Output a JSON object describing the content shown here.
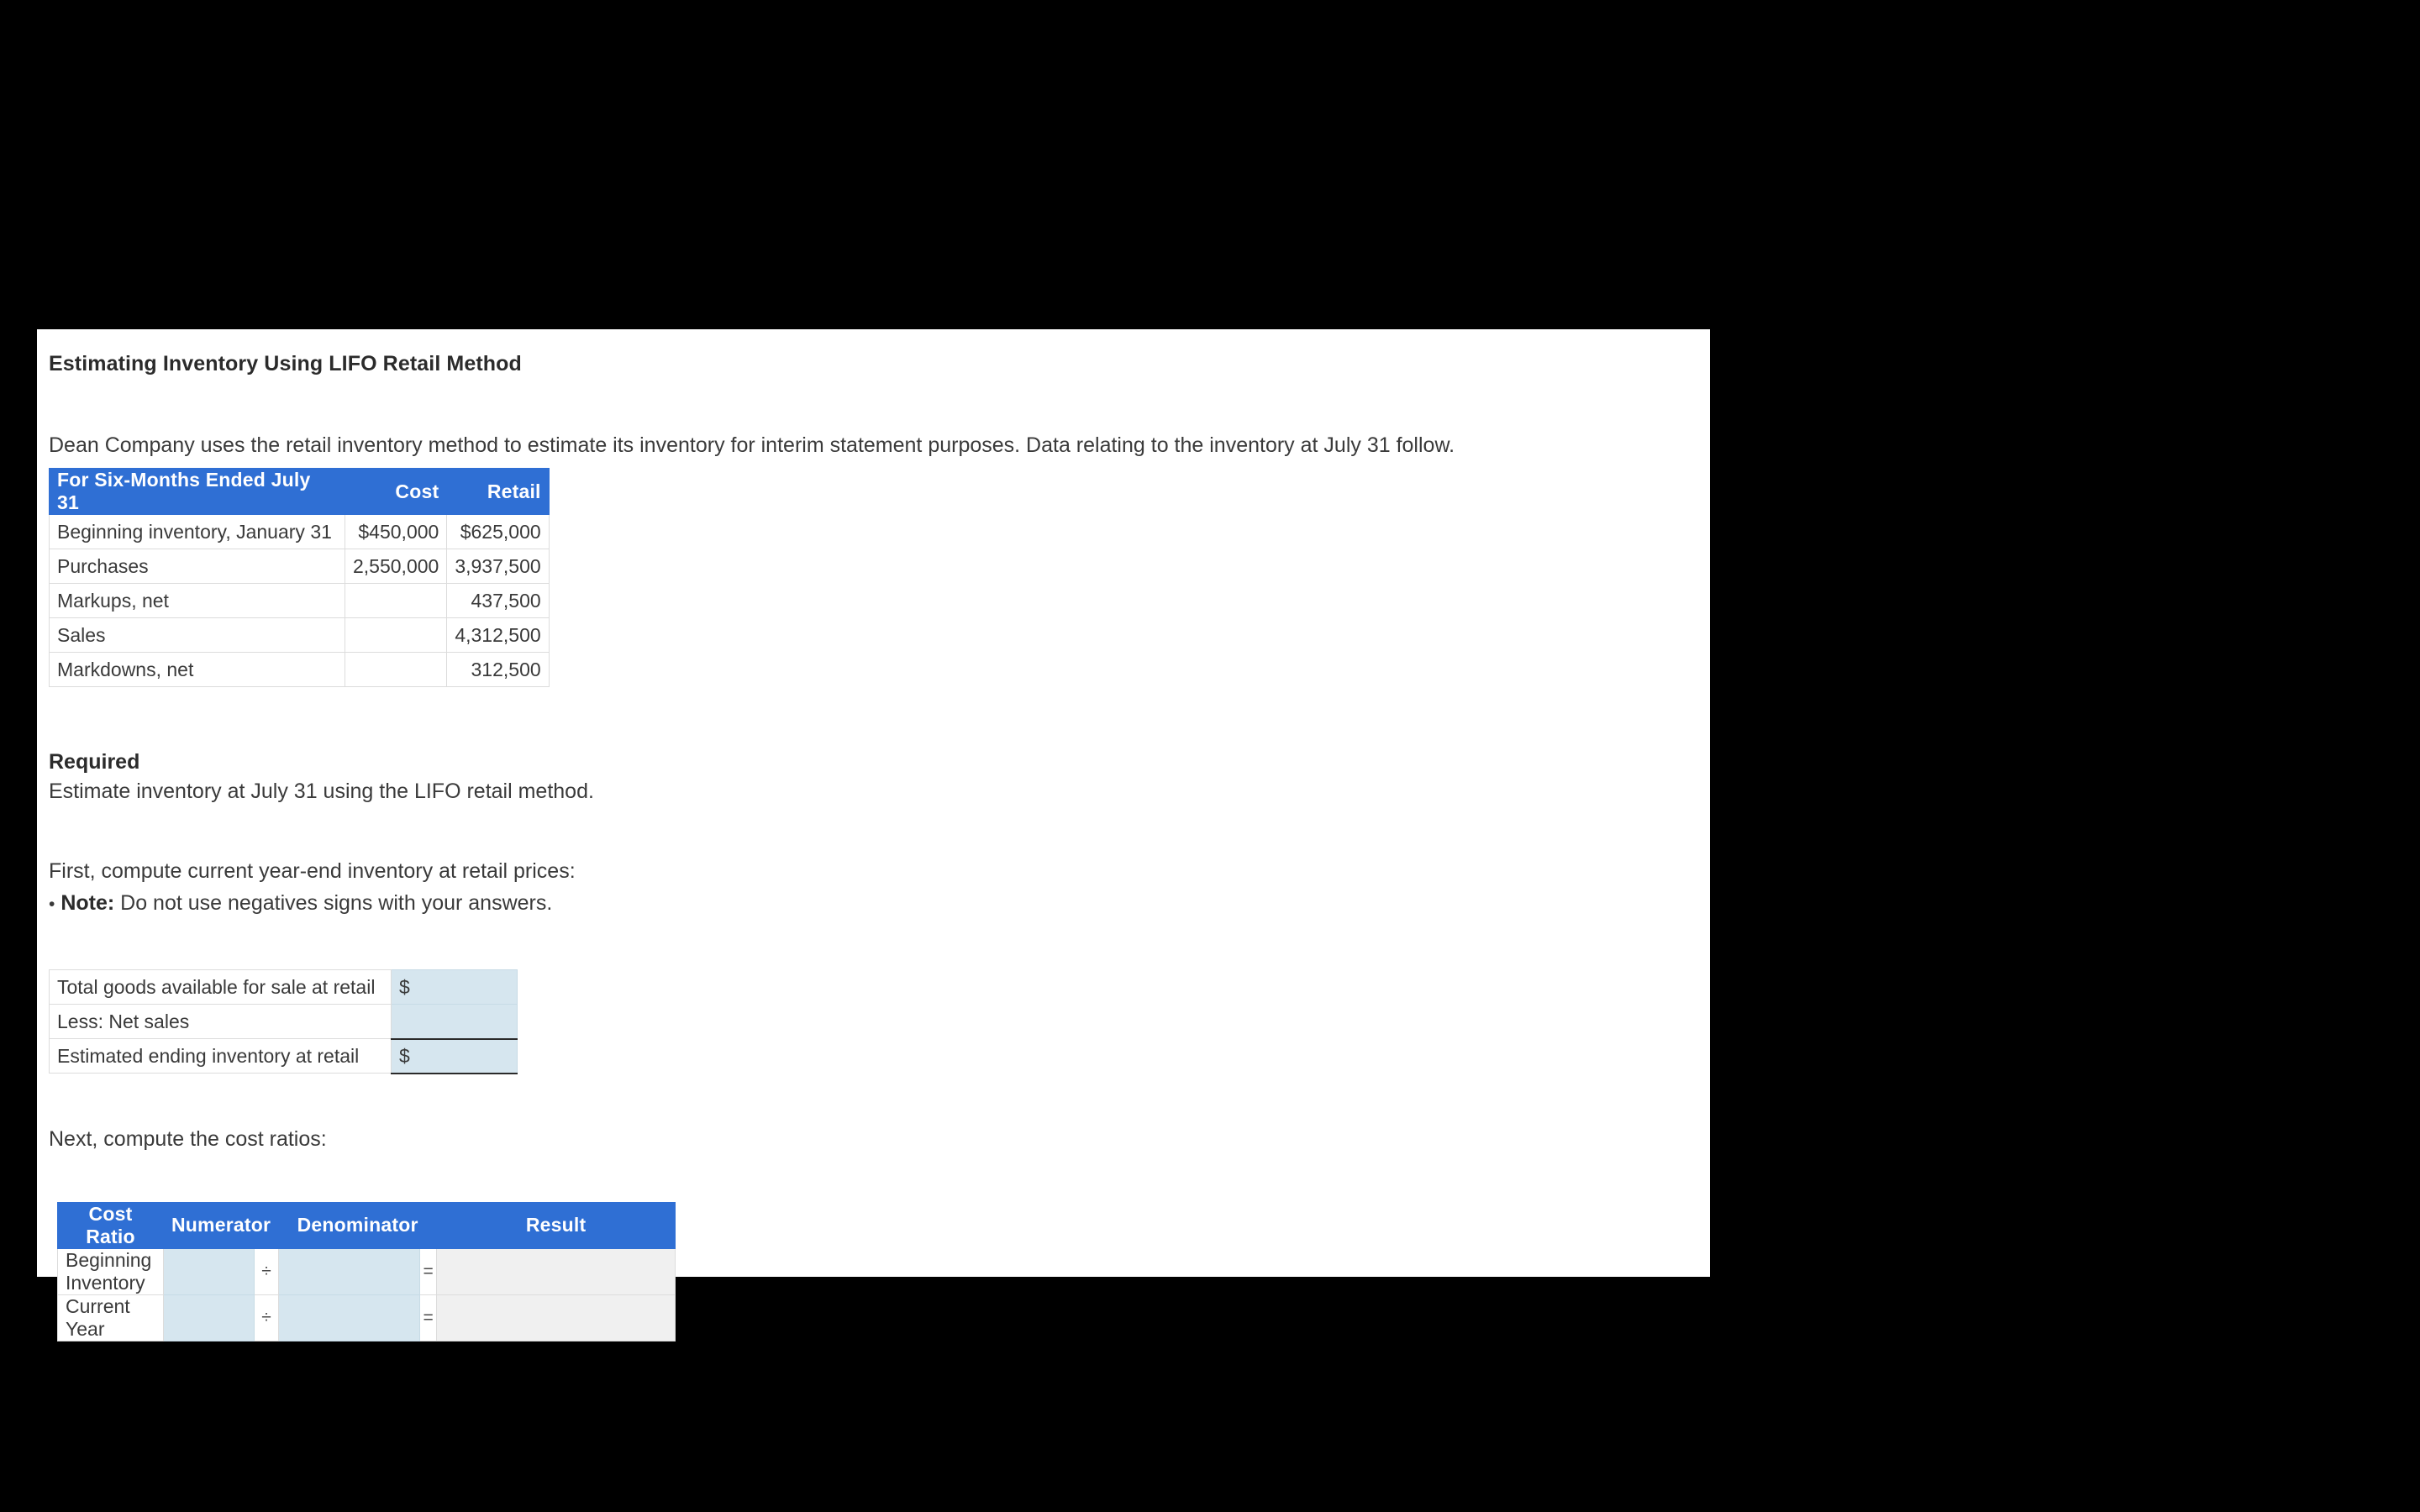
{
  "document": {
    "title": "Estimating Inventory Using LIFO Retail Method",
    "intro": "Dean Company uses the retail inventory method to estimate its inventory for interim statement purposes. Data relating to the inventory at July 31 follow.",
    "required_heading": "Required",
    "required_text": "Estimate inventory at July 31 using the LIFO retail method.",
    "first_instruction": "First, compute current year-end inventory at retail prices:",
    "note_bullet": "•",
    "note_label": "Note:",
    "note_text": "Do not use negatives signs with your answers.",
    "next_instruction": "Next, compute the cost ratios:"
  },
  "colors": {
    "header_blue": "#2f6fd4",
    "input_blue": "#d6e6ef",
    "result_gray": "#f0f0f0",
    "border_gray": "#dcdcdc",
    "text": "#3a3a3a",
    "page_background": "#000000",
    "content_background": "#ffffff"
  },
  "data_table": {
    "headers": [
      "For Six-Months Ended July 31",
      "Cost",
      "Retail"
    ],
    "rows": [
      {
        "label": "Beginning inventory, January 31",
        "cost": "$450,000",
        "retail": "$625,000"
      },
      {
        "label": "Purchases",
        "cost": "2,550,000",
        "retail": "3,937,500"
      },
      {
        "label": "Markups, net",
        "cost": "",
        "retail": "437,500"
      },
      {
        "label": "Sales",
        "cost": "",
        "retail": "4,312,500"
      },
      {
        "label": "Markdowns, net",
        "cost": "",
        "retail": "312,500"
      }
    ]
  },
  "retail_table": {
    "rows": [
      {
        "label": "Total goods available for sale at retail",
        "prefix": "$",
        "value": ""
      },
      {
        "label": "Less: Net sales",
        "prefix": "",
        "value": ""
      },
      {
        "label": "Estimated ending inventory at retail",
        "prefix": "$",
        "value": ""
      }
    ]
  },
  "ratio_table": {
    "headers": [
      "Cost Ratio",
      "Numerator",
      "Denominator",
      "Result"
    ],
    "operators": {
      "divide": "÷",
      "equals": "="
    },
    "rows": [
      {
        "name": "Beginning Inventory",
        "numerator": "",
        "divide": "÷",
        "denominator": "",
        "equals": "=",
        "result": ""
      },
      {
        "name": "Current Year",
        "numerator": "",
        "divide": "÷",
        "denominator": "",
        "equals": "=",
        "result": ""
      }
    ]
  }
}
